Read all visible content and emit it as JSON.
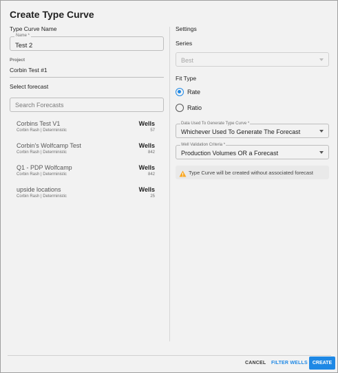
{
  "dialog": {
    "title": "Create Type Curve"
  },
  "left": {
    "type_curve_name_label": "Type Curve Name",
    "name_field": {
      "label": "Name *",
      "value": "Test 2"
    },
    "project_label": "Project",
    "project_value": "Corbin Test #1",
    "select_forecast_label": "Select forecast",
    "search": {
      "placeholder": "Search Forecasts",
      "value": ""
    },
    "forecasts": [
      {
        "name": "Corbins Test V1",
        "sub": "Corbin Rash | Deterministic",
        "wells_label": "Wells",
        "count": "57"
      },
      {
        "name": "Corbin's Wolfcamp Test",
        "sub": "Corbin Rash | Deterministic",
        "wells_label": "Wells",
        "count": "842"
      },
      {
        "name": "Q1 - PDP Wolfcamp",
        "sub": "Corbin Rash | Deterministic",
        "wells_label": "Wells",
        "count": "842"
      },
      {
        "name": "upside locations",
        "sub": "Corbin Rash | Deterministic",
        "wells_label": "Wells",
        "count": "25"
      }
    ]
  },
  "right": {
    "settings_label": "Settings",
    "series_label": "Series",
    "series_value": "Best",
    "fit_type_label": "Fit Type",
    "fit_options": [
      {
        "label": "Rate",
        "checked": true
      },
      {
        "label": "Ratio",
        "checked": false
      }
    ],
    "data_used": {
      "label": "Data Used To Generate Type Curve *",
      "value": "Whichever Used To Generate The Forecast"
    },
    "well_validation": {
      "label": "Well Validation Criteria *",
      "value": "Production Volumes OR a Forecast"
    },
    "warning_text": "Type Curve will be created without associated forecast"
  },
  "footer": {
    "cancel": "CANCEL",
    "filter_wells": "FILTER WELLS",
    "create": "CREATE"
  },
  "colors": {
    "accent": "#1e88e5",
    "warning": "#f9a825",
    "background": "#f2f2f2"
  },
  "icons": {
    "warning": "warning-triangle-icon",
    "caret": "chevron-down-icon",
    "radio": "radio-button-icon"
  }
}
